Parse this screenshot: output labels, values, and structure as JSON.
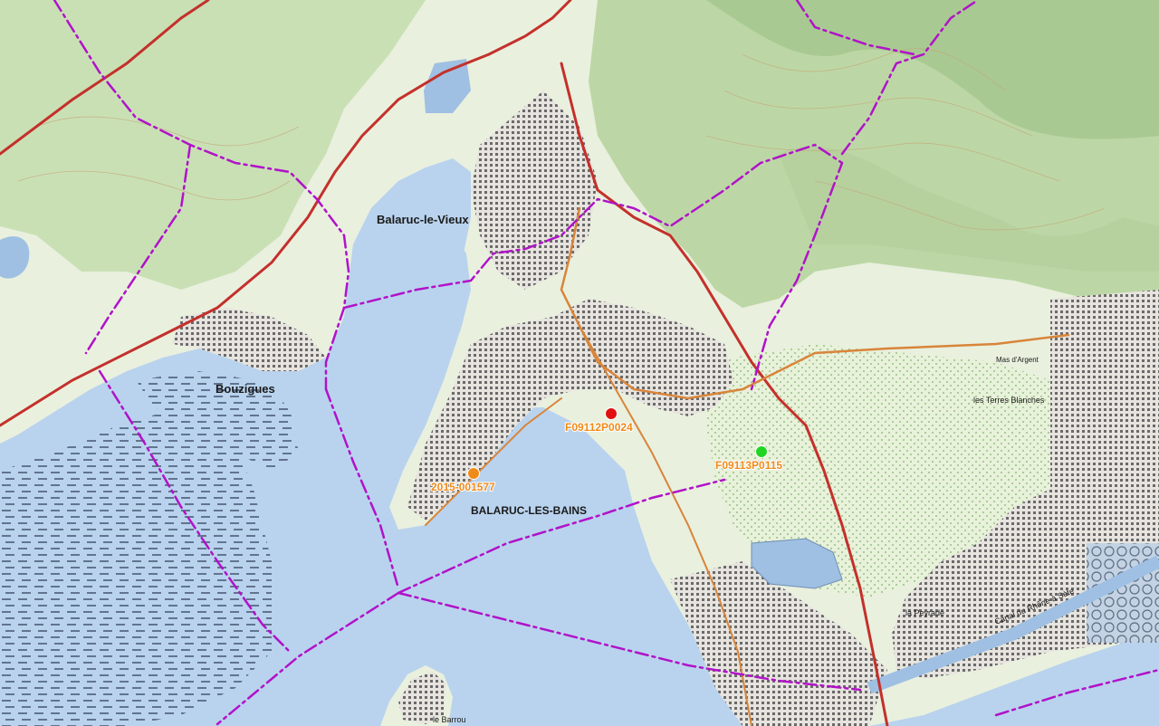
{
  "map": {
    "places": {
      "balaruc_le_vieux": "Balaruc-le-Vieux",
      "bouzigues": "Bouzigues",
      "balaruc_les_bains": "BALARUC-LES-BAINS",
      "la_peyrade": "la Peyrade",
      "le_barrou": "le Barrou",
      "mas_d_argent": "Mas d'Argent",
      "terres_blanches": "les Terres Blanches",
      "canal_du_rhone": "Canal du Rhône à Sète"
    },
    "markers": [
      {
        "id": "F09112P0024",
        "color": "#e01010"
      },
      {
        "id": "F09113P0115",
        "color": "#22d522"
      },
      {
        "id": "2015-001577",
        "color": "#f08a19"
      }
    ],
    "colors": {
      "water": "#b9d3ee",
      "land": "#e9f0de",
      "forest": "#c9e0b5",
      "urban": "#7a7a7a",
      "boundary": "#b112c9",
      "road_main": "#c4302b",
      "road_secondary": "#d8853a"
    }
  }
}
